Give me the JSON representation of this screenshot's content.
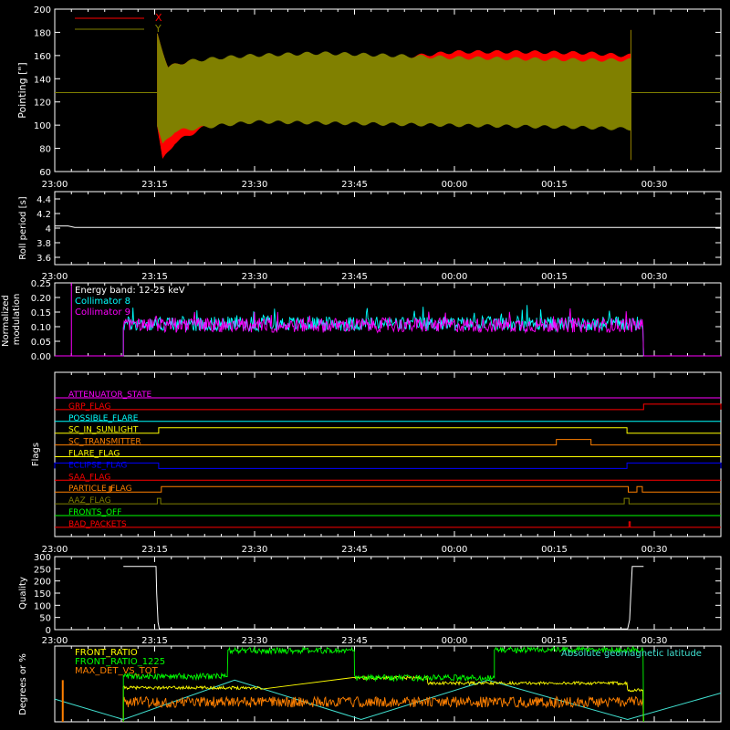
{
  "time_ticks": [
    "23:00",
    "23:15",
    "23:30",
    "23:45",
    "00:00",
    "00:15",
    "00:30"
  ],
  "colors": {
    "axis": "#ffffff",
    "red": "#ff0000",
    "olive": "#808000",
    "cyan": "#00ffff",
    "magenta": "#ff00ff",
    "yellow": "#ffff00",
    "orange": "#ff8000",
    "green": "#00ff00",
    "blue": "#0000ff",
    "lightcyan": "#40e0d0"
  },
  "chart_data": [
    {
      "id": "pointing",
      "type": "area",
      "ylabel": "Pointing [\"]",
      "ylim": [
        60,
        200
      ],
      "yticks": [
        60,
        80,
        100,
        120,
        140,
        160,
        180,
        200
      ],
      "x_unit": "minutes after 23:00",
      "series": [
        {
          "name": "X",
          "color": "red",
          "baseline": 128,
          "active_start": 15.4,
          "active_end": 86.5,
          "upper": [
            [
              15.4,
              178
            ],
            [
              17,
              150
            ],
            [
              20,
              155
            ],
            [
              25,
              156
            ],
            [
              30,
              155
            ],
            [
              40,
              152
            ],
            [
              50,
              157
            ],
            [
              60,
              163
            ],
            [
              70,
              163
            ],
            [
              80,
              162
            ],
            [
              85,
              160
            ]
          ],
          "lower": [
            [
              15.4,
              100
            ],
            [
              16.2,
              70
            ],
            [
              18,
              85
            ],
            [
              25,
              106
            ],
            [
              30,
              112
            ],
            [
              35,
              114
            ],
            [
              40,
              118
            ],
            [
              50,
              123
            ],
            [
              60,
              125
            ],
            [
              70,
              127
            ],
            [
              80,
              129
            ],
            [
              85,
              131
            ]
          ]
        },
        {
          "name": "Y",
          "color": "olive",
          "baseline": 128,
          "active_start": 15.4,
          "active_end": 86.5,
          "upper": [
            [
              15.4,
              178
            ],
            [
              17,
              150
            ],
            [
              20,
              155
            ],
            [
              25,
              158
            ],
            [
              30,
              160
            ],
            [
              40,
              162
            ],
            [
              50,
              160
            ],
            [
              60,
              158
            ],
            [
              70,
              157
            ],
            [
              80,
              156
            ],
            [
              85,
              156
            ]
          ],
          "lower": [
            [
              15.4,
              100
            ],
            [
              16.2,
              83
            ],
            [
              18,
              95
            ],
            [
              25,
              100
            ],
            [
              30,
              103
            ],
            [
              40,
              102
            ],
            [
              50,
              101
            ],
            [
              60,
              100
            ],
            [
              70,
              99
            ],
            [
              80,
              98
            ],
            [
              85,
              97
            ]
          ]
        }
      ]
    },
    {
      "id": "roll",
      "type": "line",
      "ylabel": "Roll period [s]",
      "ylim": [
        3.5,
        4.5
      ],
      "yticks": [
        3.6,
        3.8,
        4.0,
        4.2,
        4.4
      ],
      "series": [
        {
          "name": "",
          "color": "axis",
          "points": [
            [
              0,
              4.03
            ],
            [
              2,
              4.03
            ],
            [
              3,
              4.01
            ],
            [
              100,
              4.01
            ]
          ]
        }
      ]
    },
    {
      "id": "modulation",
      "type": "line",
      "ylabel": "Normalized modulation",
      "ylim": [
        0,
        0.25
      ],
      "yticks": [
        "0.00",
        "0.05",
        "0.10",
        "0.15",
        "0.20",
        "0.25"
      ],
      "annotation": "Energy band: 12-25 keV",
      "series": [
        {
          "name": "Collimator 8",
          "color": "cyan",
          "mean": 0.11,
          "start": 10.3,
          "end": 88.4
        },
        {
          "name": "Collimator 9",
          "color": "magenta",
          "mean": 0.105,
          "start": 10.3,
          "end": 88.4,
          "spike_at": 2.5
        }
      ]
    },
    {
      "id": "flags",
      "type": "line",
      "ylabel": "Flags",
      "flags": [
        {
          "name": "ATTENUATOR_STATE",
          "color": "magenta",
          "high": []
        },
        {
          "name": "GRP_FLAG",
          "color": "red",
          "high": [
            [
              88.4,
              100
            ]
          ]
        },
        {
          "name": "POSSIBLE_FLARE",
          "color": "cyan",
          "high": []
        },
        {
          "name": "SC_IN_SUNLIGHT",
          "color": "yellow",
          "high": [
            [
              15.6,
              85.9
            ]
          ]
        },
        {
          "name": "SC_TRANSMITTER",
          "color": "orange",
          "high": [
            [
              75.3,
              80.5
            ]
          ]
        },
        {
          "name": "FLARE_FLAG",
          "color": "yellow",
          "high": []
        },
        {
          "name": "ECLIPSE_FLAG",
          "color": "blue",
          "high": [
            [
              0,
              15.6
            ],
            [
              85.9,
              100
            ]
          ]
        },
        {
          "name": "SAA_FLAG",
          "color": "red",
          "high": []
        },
        {
          "name": "PARTICLE_FLAG",
          "color": "orange",
          "high": [
            [
              8.2,
              8.4
            ],
            [
              16.0,
              86.1
            ],
            [
              87.4,
              88.2
            ]
          ]
        },
        {
          "name": "AAZ_FLAG",
          "color": "olive",
          "high": [
            [
              15.4,
              15.9
            ],
            [
              85.5,
              86.2
            ]
          ]
        },
        {
          "name": "FRONTS_OFF",
          "color": "green",
          "high": []
        },
        {
          "name": "BAD_PACKETS",
          "color": "red",
          "high": [
            [
              86.2,
              86.4
            ]
          ]
        }
      ]
    },
    {
      "id": "quality",
      "type": "line",
      "ylabel": "Quality",
      "ylim": [
        0,
        300
      ],
      "yticks": [
        0,
        50,
        100,
        150,
        200,
        250,
        300
      ],
      "series": [
        {
          "name": "",
          "color": "axis",
          "points": [
            [
              10.3,
              260
            ],
            [
              15.2,
              260
            ],
            [
              15.3,
              150
            ],
            [
              15.5,
              30
            ],
            [
              15.7,
              3
            ],
            [
              86.0,
              3
            ],
            [
              86.3,
              40
            ],
            [
              86.5,
              160
            ],
            [
              86.7,
              260
            ],
            [
              88.4,
              260
            ]
          ]
        }
      ]
    },
    {
      "id": "ratios",
      "type": "line",
      "ylabel": "Degrees or %",
      "ylim": [
        0,
        100
      ],
      "series": [
        {
          "name": "FRONT_RATIO",
          "color": "yellow",
          "segments": [
            [
              10.3,
              31,
              45
            ],
            [
              45,
              56,
              58
            ],
            [
              56,
              86,
              51
            ],
            [
              86,
              88.4,
              42
            ]
          ],
          "noise": 2
        },
        {
          "name": "FRONT_RATIO_1225",
          "color": "green",
          "segments": [
            [
              10.3,
              26,
              60
            ],
            [
              26,
              45,
              94
            ],
            [
              45,
              66,
              58
            ],
            [
              66,
              88.4,
              95
            ]
          ],
          "noise": 4
        },
        {
          "name": "MAX_DET_VS_TOT",
          "color": "orange",
          "segments": [
            [
              10.3,
              88.4,
              26
            ]
          ],
          "noise": 7
        },
        {
          "name": "Absolute geomagnetic latitude",
          "color": "lightcyan",
          "points": [
            [
              0,
              30
            ],
            [
              10.3,
              3
            ],
            [
              27,
              55
            ],
            [
              46,
              3
            ],
            [
              65,
              55
            ],
            [
              86,
              3
            ],
            [
              100,
              38
            ]
          ]
        }
      ],
      "extra_bar": {
        "x": 1.2,
        "value": 55,
        "color": "orange"
      }
    }
  ]
}
